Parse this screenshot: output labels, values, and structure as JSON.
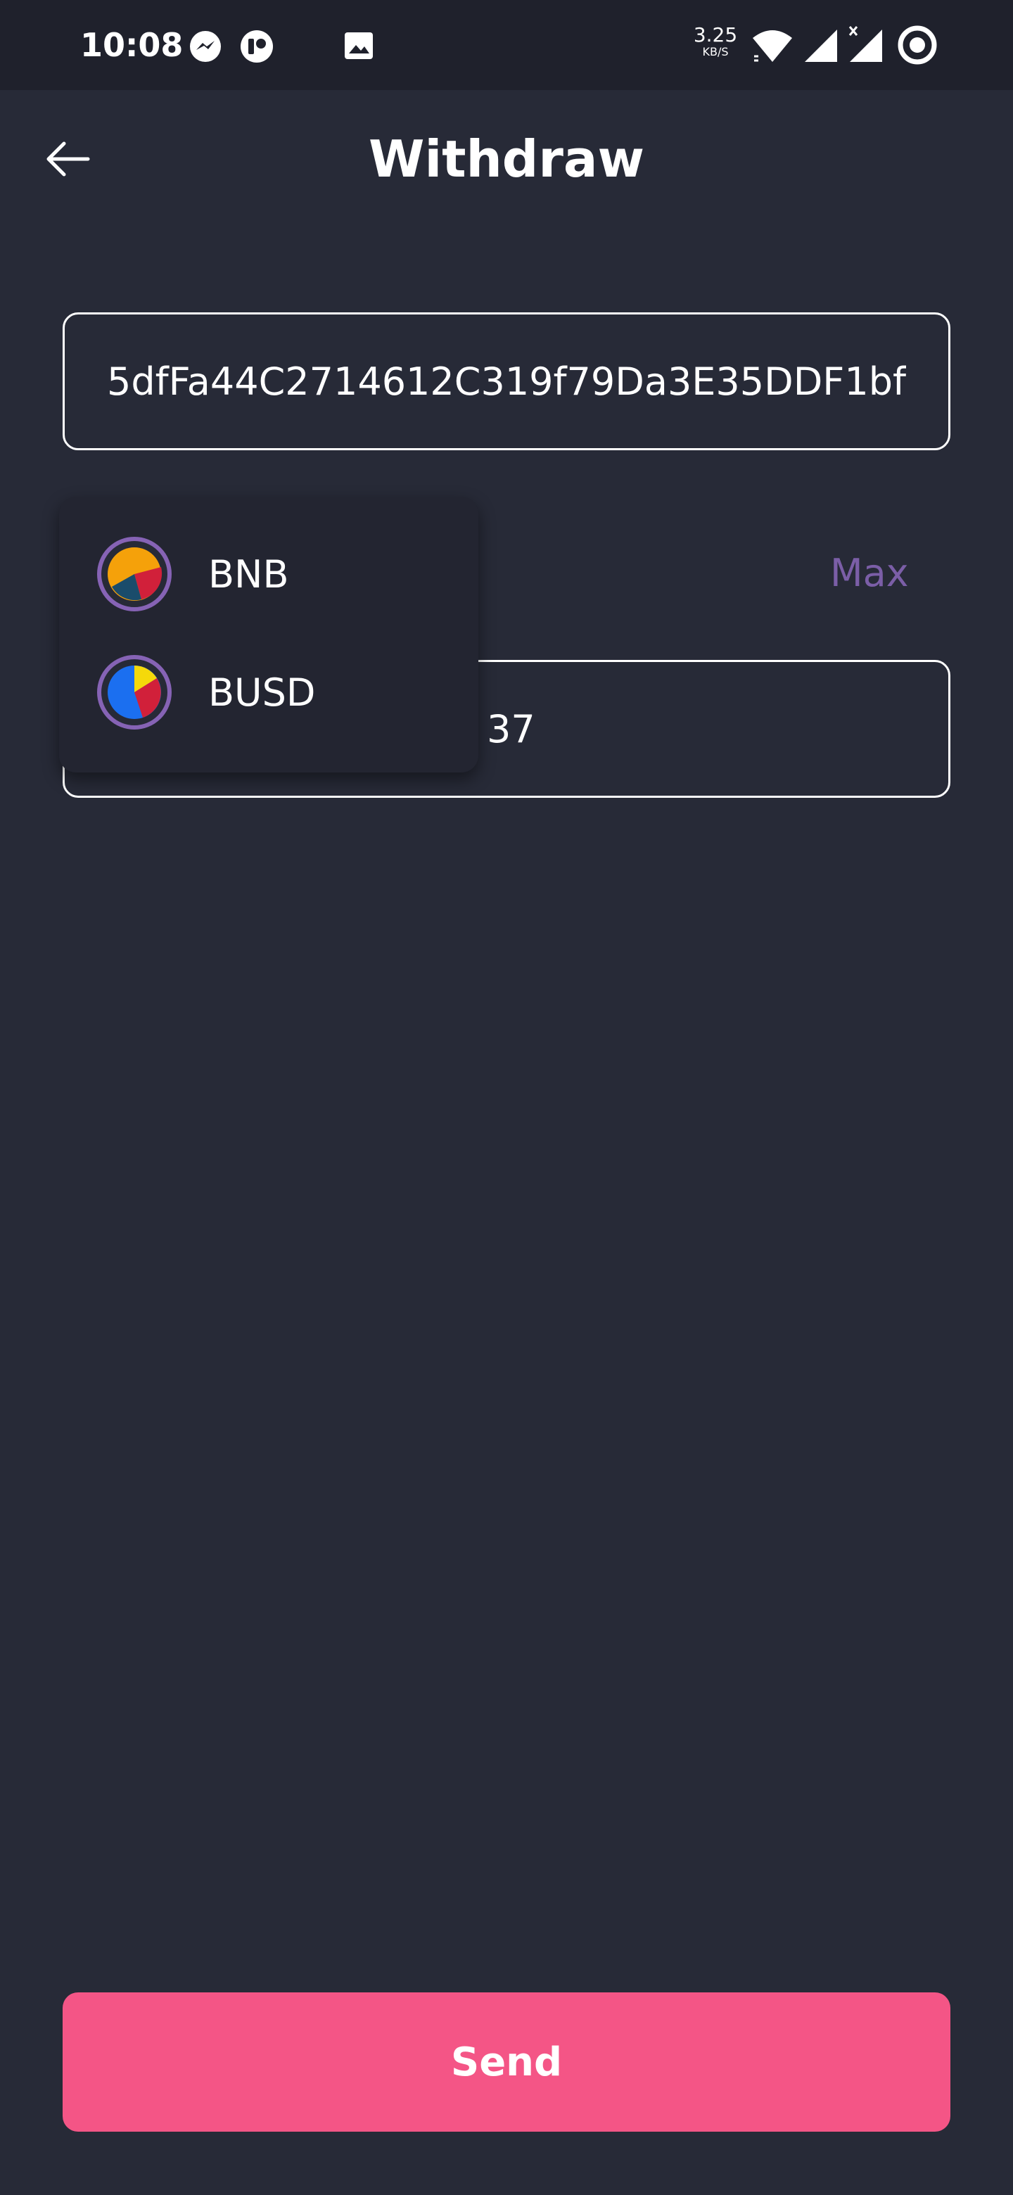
{
  "status_bar": {
    "time": "10:08",
    "network_speed": "3.25",
    "network_speed_unit": "KB/S",
    "icons": [
      "messenger-icon",
      "app-notification-icon",
      "image-icon",
      "wifi-icon",
      "signal-icon",
      "signal-no-data-icon",
      "focus-mode-icon"
    ]
  },
  "header": {
    "back_icon": "arrow-left-icon",
    "title": "Withdraw"
  },
  "address_field": {
    "value": "5dfFa44C2714612C319f79Da3E35DDF1bf"
  },
  "amount_section": {
    "max_label": "Max",
    "value_visible": "37"
  },
  "token_dropdown": {
    "items": [
      {
        "label": "BNB",
        "icon": "bnb-token-icon"
      },
      {
        "label": "BUSD",
        "icon": "busd-token-icon"
      }
    ]
  },
  "send_button": {
    "label": "Send"
  },
  "colors": {
    "background": "#272a37",
    "status_bar": "#1f212c",
    "dropdown": "#232531",
    "accent_purple": "#7b5ea7",
    "primary_pink": "#f45586",
    "coin_ring": "#8663b5"
  }
}
